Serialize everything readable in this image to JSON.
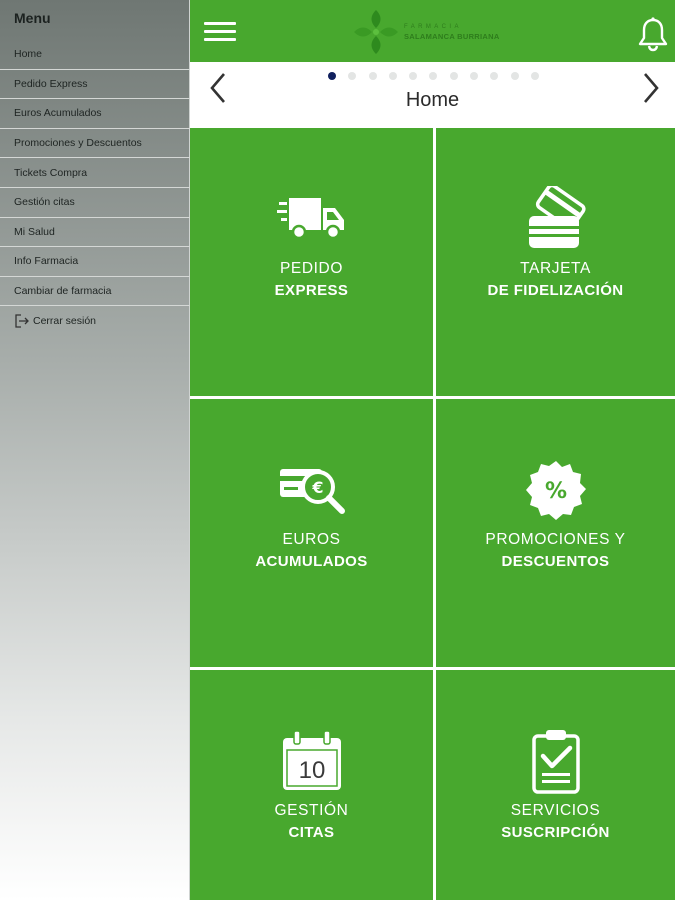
{
  "sidebar": {
    "title": "Menu",
    "items": [
      {
        "label": "Home"
      },
      {
        "label": "Pedido Express"
      },
      {
        "label": "Euros Acumulados"
      },
      {
        "label": "Promociones y Descuentos"
      },
      {
        "label": "Tickets Compra"
      },
      {
        "label": "Gestión citas"
      },
      {
        "label": "Mi Salud"
      },
      {
        "label": "Info Farmacia"
      },
      {
        "label": "Cambiar de farmacia"
      },
      {
        "label": "Cerrar sesión",
        "icon": "logout-icon"
      }
    ]
  },
  "header": {
    "brand_small": "FARMACIA",
    "brand_name": "SALAMANCA BURRIANA",
    "menu_icon": "hamburger-menu-icon",
    "notification_icon": "bell-icon",
    "colors": {
      "primary": "#48a82e",
      "logo": "#2e7d1c"
    }
  },
  "nav": {
    "title": "Home",
    "prev_icon": "chevron-left-icon",
    "next_icon": "chevron-right-icon",
    "page_count": 11,
    "active_page": 1,
    "active_dot_color": "#10205e"
  },
  "tiles": [
    {
      "line1": "PEDIDO",
      "line2": "EXPRESS",
      "icon": "delivery-truck-icon"
    },
    {
      "line1": "TARJETA",
      "line2": "DE FIDELIZACIÓN",
      "icon": "loyalty-card-icon"
    },
    {
      "line1": "EUROS",
      "line2": "ACUMULADOS",
      "icon": "euro-card-search-icon"
    },
    {
      "line1": "PROMOCIONES Y",
      "line2": "DESCUENTOS",
      "icon": "discount-percent-icon"
    },
    {
      "line1": "GESTIÓN",
      "line2": "CITAS",
      "icon": "calendar-icon",
      "calendar_day": "10"
    },
    {
      "line1": "SERVICIOS",
      "line2": "SUSCRIPCIÓN",
      "icon": "clipboard-check-icon"
    }
  ]
}
